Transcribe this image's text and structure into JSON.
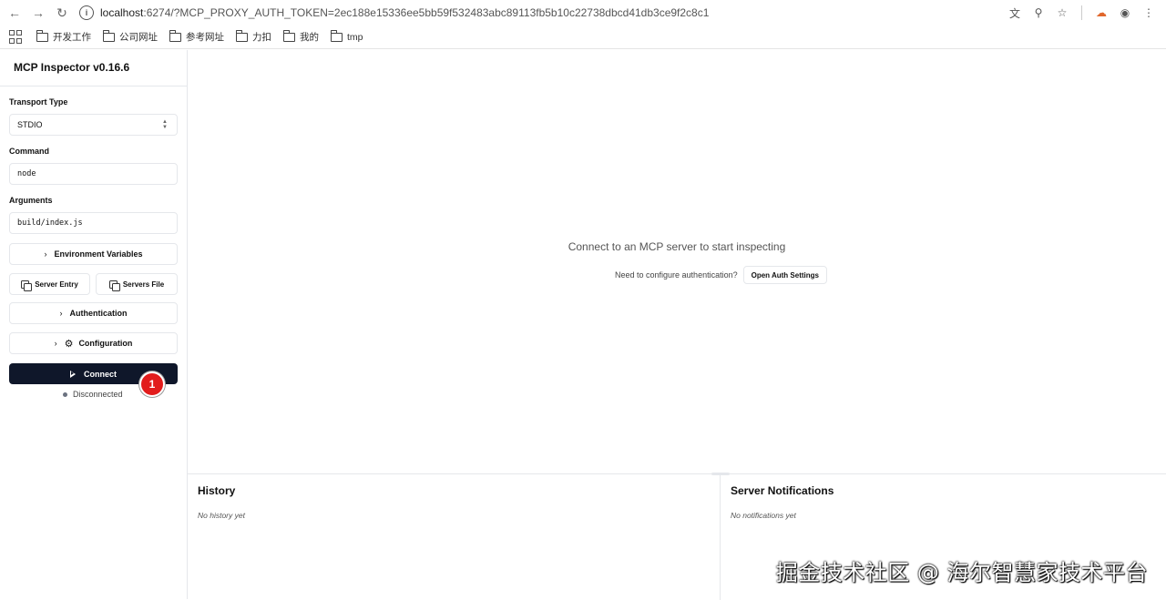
{
  "browser": {
    "url_host": "localhost",
    "url_rest": ":6274/?MCP_PROXY_AUTH_TOKEN=2ec188e15336ee5bb59f532483abc89113fb5b10c22738dbcd41db3ce9f2c8c1",
    "bookmarks": [
      "开发工作",
      "公司网址",
      "参考网址",
      "力扣",
      "我的",
      "tmp"
    ]
  },
  "sidebar": {
    "title": "MCP Inspector v0.16.6",
    "transport_label": "Transport Type",
    "transport_value": "STDIO",
    "command_label": "Command",
    "command_value": "node",
    "arguments_label": "Arguments",
    "arguments_value": "build/index.js",
    "env_vars_label": "Environment Variables",
    "server_entry_label": "Server Entry",
    "servers_file_label": "Servers File",
    "authentication_label": "Authentication",
    "configuration_label": "Configuration",
    "connect_label": "Connect",
    "badge_number": "1",
    "status_text": "Disconnected"
  },
  "main": {
    "empty_title": "Connect to an MCP server to start inspecting",
    "auth_prompt": "Need to configure authentication?",
    "open_auth_label": "Open Auth Settings"
  },
  "history": {
    "title": "History",
    "empty": "No history yet"
  },
  "notifications": {
    "title": "Server Notifications",
    "empty": "No notifications yet"
  },
  "watermark": "掘金技术社区 @ 海尔智慧家技术平台"
}
